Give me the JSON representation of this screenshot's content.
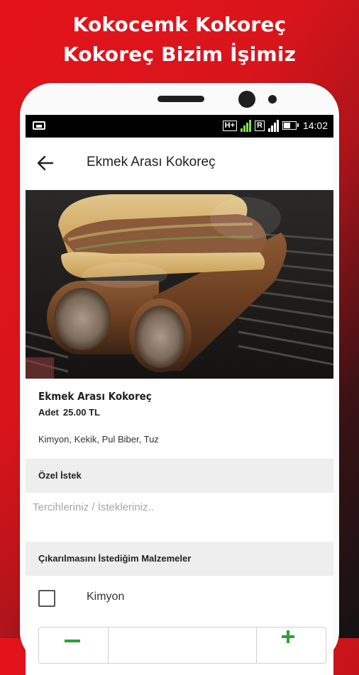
{
  "promo": {
    "line1": "Kokocemk Kokoreç",
    "line2": "Kokoreç Bizim İşimiz"
  },
  "status_bar": {
    "network_1": "H+",
    "network_2": "R",
    "time": "14:02"
  },
  "app_bar": {
    "back_icon": "arrow-left-icon",
    "title": "Ekmek Arası Kokoreç"
  },
  "product": {
    "name": "Ekmek Arası Kokoreç",
    "unit_label": "Adet",
    "price": "25.00 TL",
    "ingredients": "Kimyon, Kekik, Pul Biber, Tuz"
  },
  "special_request": {
    "header": "Özel İstek",
    "placeholder": "Tercihleriniz / İstekleriniz.."
  },
  "remove_ingredients": {
    "header": "Çıkarılmasını İstediğim Malzemeler",
    "items": [
      {
        "label": "Kimyon",
        "checked": false
      }
    ]
  },
  "colors": {
    "brand_red": "#e3131b",
    "stepper_green": "#2e9e3a"
  }
}
